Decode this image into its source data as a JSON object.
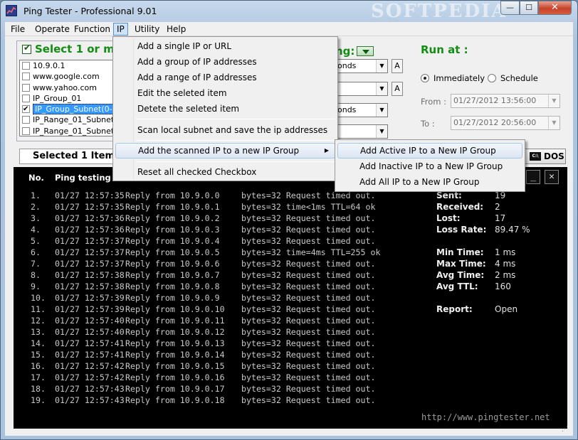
{
  "window": {
    "title": "Ping Tester - Professional  9.01",
    "watermark": "SOFTPEDIA",
    "min_glyph": "—",
    "max_glyph": "☐",
    "close_glyph": "✕"
  },
  "menubar": [
    "File",
    "Operate",
    "Function",
    "IP",
    "Utility",
    "Help"
  ],
  "ip_panel": {
    "select_all_label": "Select 1 or mo",
    "items": [
      {
        "label": "10.9.0.1",
        "checked": false,
        "selected": false
      },
      {
        "label": "www.google.com",
        "checked": false,
        "selected": false
      },
      {
        "label": "www.yahoo.com",
        "checked": false,
        "selected": false
      },
      {
        "label": "IP_Group_01",
        "checked": false,
        "selected": false
      },
      {
        "label": "IP_Group_Subnet(0-255",
        "checked": true,
        "selected": true
      },
      {
        "label": "IP_Range_01_Subnet_",
        "checked": false,
        "selected": false
      },
      {
        "label": "IP_Range_01_Subnet_",
        "checked": false,
        "selected": false
      }
    ],
    "selected_items": "Selected 1 Items"
  },
  "middle": {
    "ping_label": "ng:",
    "combo1": "onds",
    "combo3": "onds",
    "a_label": "A"
  },
  "run_at": {
    "title": "Run at :",
    "immediately": "Immediately",
    "schedule": "Schedule",
    "from_label": "From :",
    "to_label": "To :",
    "from_value": "01/27/2012 13:56:00",
    "to_value": "01/27/2012 20:56:00"
  },
  "dos_label": "DOS",
  "dos_icon_text": "C:\\",
  "console": {
    "header_no": "No.",
    "header_info": "Ping testing wit",
    "rows": [
      {
        "no": "1.",
        "time": "01/27 12:57:35",
        "reply": "Reply from 10.9.0.0",
        "result": "bytes=32 Request timed out."
      },
      {
        "no": "2.",
        "time": "01/27 12:57:35",
        "reply": "Reply from 10.9.0.1",
        "result": "bytes=32 time<1ms TTL=64 ok"
      },
      {
        "no": "3.",
        "time": "01/27 12:57:36",
        "reply": "Reply from 10.9.0.2",
        "result": "bytes=32 Request timed out."
      },
      {
        "no": "4.",
        "time": "01/27 12:57:36",
        "reply": "Reply from 10.9.0.3",
        "result": "bytes=32 Request timed out."
      },
      {
        "no": "5.",
        "time": "01/27 12:57:37",
        "reply": "Reply from 10.9.0.4",
        "result": "bytes=32 Request timed out."
      },
      {
        "no": "6.",
        "time": "01/27 12:57:37",
        "reply": "Reply from 10.9.0.5",
        "result": "bytes=32 time=4ms TTL=255 ok"
      },
      {
        "no": "7.",
        "time": "01/27 12:57:37",
        "reply": "Reply from 10.9.0.6",
        "result": "bytes=32 Request timed out."
      },
      {
        "no": "8.",
        "time": "01/27 12:57:38",
        "reply": "Reply from 10.9.0.7",
        "result": "bytes=32 Request timed out."
      },
      {
        "no": "9.",
        "time": "01/27 12:57:38",
        "reply": "Reply from 10.9.0.8",
        "result": "bytes=32 Request timed out."
      },
      {
        "no": "10.",
        "time": "01/27 12:57:39",
        "reply": "Reply from 10.9.0.9",
        "result": "bytes=32 Request timed out."
      },
      {
        "no": "11.",
        "time": "01/27 12:57:39",
        "reply": "Reply from 10.9.0.10",
        "result": "bytes=32 Request timed out."
      },
      {
        "no": "12.",
        "time": "01/27 12:57:40",
        "reply": "Reply from 10.9.0.11",
        "result": "bytes=32 Request timed out."
      },
      {
        "no": "13.",
        "time": "01/27 12:57:40",
        "reply": "Reply from 10.9.0.12",
        "result": "bytes=32 Request timed out."
      },
      {
        "no": "14.",
        "time": "01/27 12:57:41",
        "reply": "Reply from 10.9.0.13",
        "result": "bytes=32 Request timed out."
      },
      {
        "no": "15.",
        "time": "01/27 12:57:41",
        "reply": "Reply from 10.9.0.14",
        "result": "bytes=32 Request timed out."
      },
      {
        "no": "16.",
        "time": "01/27 12:57:42",
        "reply": "Reply from 10.9.0.15",
        "result": "bytes=32 Request timed out."
      },
      {
        "no": "17.",
        "time": "01/27 12:57:42",
        "reply": "Reply from 10.9.0.16",
        "result": "bytes=32 Request timed out."
      },
      {
        "no": "18.",
        "time": "01/27 12:57:43",
        "reply": "Reply from 10.9.0.17",
        "result": "bytes=32 Request timed out."
      },
      {
        "no": "19.",
        "time": "01/27 12:57:43",
        "reply": "Reply from 10.9.0.18",
        "result": "bytes=32 Request timed out."
      }
    ],
    "stats": [
      {
        "k": "Sent:",
        "v": "19"
      },
      {
        "k": "Received:",
        "v": "2"
      },
      {
        "k": "Lost:",
        "v": "17"
      },
      {
        "k": "Loss Rate:",
        "v": "89.47 %"
      },
      {
        "k": "Min Time:",
        "v": "1 ms"
      },
      {
        "k": "Max Time:",
        "v": "4 ms"
      },
      {
        "k": "Avg Time:",
        "v": "2 ms"
      },
      {
        "k": "Avg TTL:",
        "v": "160"
      },
      {
        "k": "Report:",
        "v": "Open"
      }
    ],
    "website": "http://www.pingtester.net",
    "min_glyph": "_",
    "close_glyph": "✕"
  },
  "ip_menu": {
    "items": [
      "Add a single IP or URL",
      "Add a group of IP addresses",
      "Add a range of IP addresses",
      "Edit the seleted item",
      "Detete the seleted item",
      "Scan local subnet and save the ip addresses",
      "Add the scanned IP to a new IP Group",
      "Reset all checked Checkbox"
    ],
    "submenu_arrow": "▶"
  },
  "sub_menu": {
    "items": [
      "Add Active IP to a New IP Group",
      "Add Inactive IP to a New IP Group",
      "Add All IP to a New IP Group"
    ]
  },
  "colors": {
    "accent_green": "#138c13",
    "console_bg": "#000000",
    "selection_blue": "#3399ff"
  }
}
